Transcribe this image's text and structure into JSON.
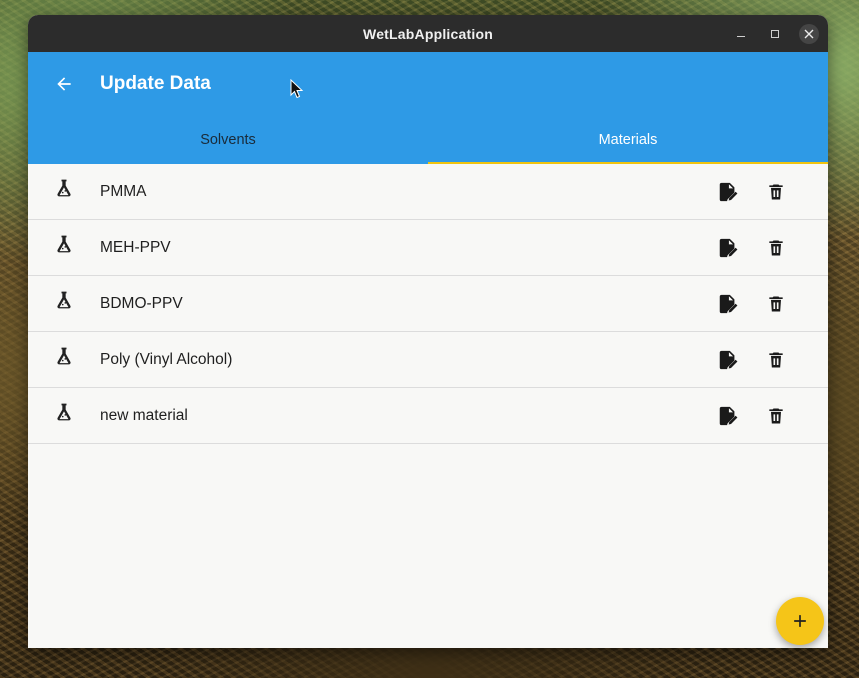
{
  "window": {
    "title": "WetLabApplication"
  },
  "appbar": {
    "title": "Update Data"
  },
  "tabs": [
    {
      "label": "Solvents",
      "active": false
    },
    {
      "label": "Materials",
      "active": true
    }
  ],
  "materials": [
    {
      "name": "PMMA",
      "icon": "flask-icon"
    },
    {
      "name": "MEH-PPV",
      "icon": "flask-icon"
    },
    {
      "name": "BDMO-PPV",
      "icon": "flask-icon"
    },
    {
      "name": "Poly (Vinyl Alcohol)",
      "icon": "flask-icon"
    },
    {
      "name": "new material",
      "icon": "flask-icon"
    }
  ],
  "row_actions": {
    "edit_icon": "edit-document-icon",
    "delete_icon": "trash-icon"
  },
  "fab": {
    "icon": "plus-icon"
  },
  "colors": {
    "primary": "#2e9ae6",
    "accent": "#f5c518",
    "tab_indicator": "#f1c40f",
    "titlebar": "#2c2c2c"
  }
}
